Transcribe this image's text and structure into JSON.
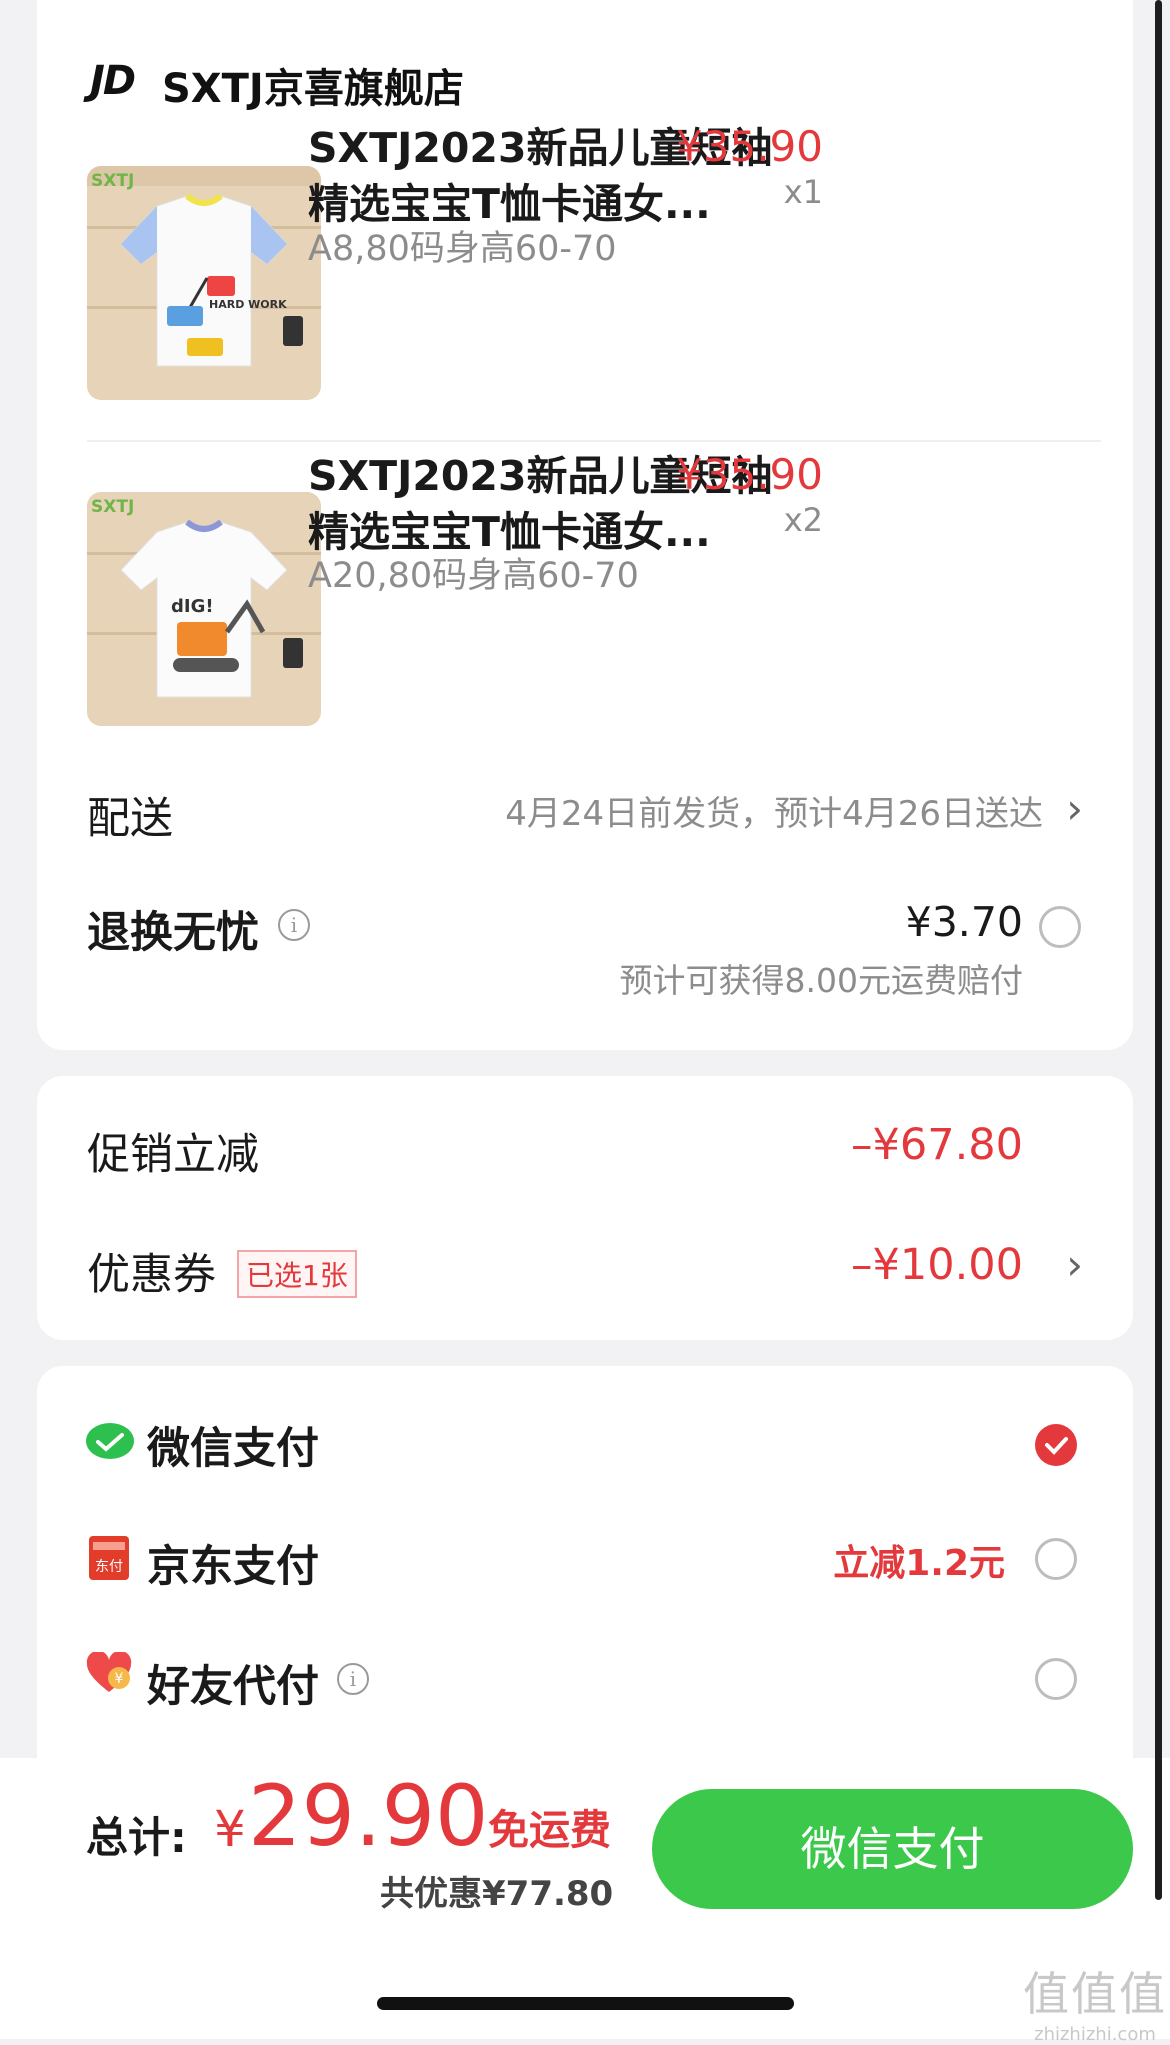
{
  "shop": {
    "logo": "JD",
    "name": "SXTJ京喜旗舰店"
  },
  "products": [
    {
      "title": "SXTJ2023新品儿童短袖精选宝宝T恤卡通女...",
      "price": "¥35.90",
      "qty": "x1",
      "sku": "A8,80码身高60-70",
      "brand_on_image": "SXTJ",
      "shirt_text": "HARD WORK"
    },
    {
      "title": "SXTJ2023新品儿童短袖精选宝宝T恤卡通女...",
      "price": "¥35.90",
      "qty": "x2",
      "sku": "A20,80码身高60-70",
      "brand_on_image": "SXTJ",
      "shirt_text": "dIG!"
    }
  ],
  "delivery": {
    "label": "配送",
    "value": "4月24日前发货，预计4月26日送达"
  },
  "return_insurance": {
    "label": "退换无忧",
    "price": "¥3.70",
    "note": "预计可获得8.00元运费赔付"
  },
  "promo": {
    "label": "促销立减",
    "value": "–¥67.80"
  },
  "coupon": {
    "label": "优惠券",
    "tag": "已选1张",
    "value": "–¥10.00"
  },
  "payment_methods": [
    {
      "label": "微信支付",
      "icon": "wechat-pay-icon",
      "selected": true
    },
    {
      "label": "京东支付",
      "icon": "jd-pay-icon",
      "icon_text": "东付",
      "promo": "立减1.2元",
      "selected": false
    },
    {
      "label": "好友代付",
      "icon": "friend-pay-icon",
      "icon_text": "¥",
      "selected": false
    }
  ],
  "footer": {
    "total_label": "总计:",
    "currency": "¥",
    "total": "29.90",
    "free_shipping": "免运费",
    "savings": "共优惠¥77.80",
    "pay_button": "微信支付"
  },
  "watermark": {
    "glyphs": "值值值",
    "url": "zhizhizhi.com"
  },
  "colors": {
    "accent_red": "#e4393c",
    "wechat_green": "#3cc84b",
    "background": "#f2f2f4"
  }
}
